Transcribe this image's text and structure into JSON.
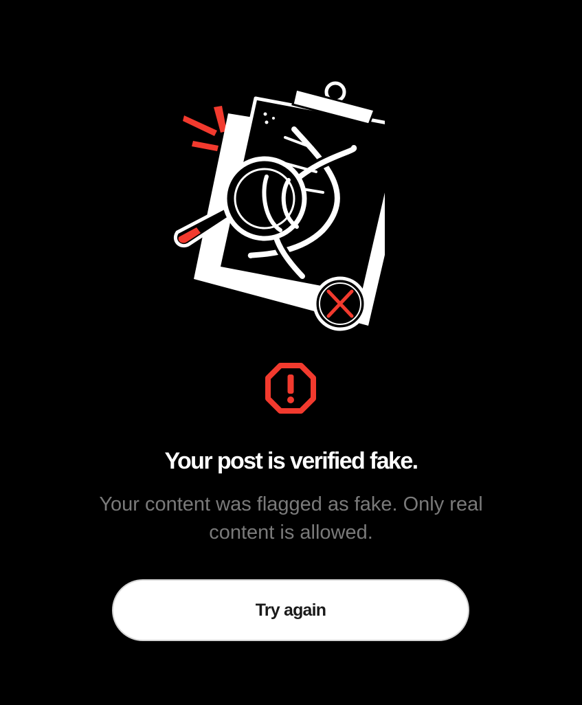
{
  "icons": {
    "illustration": "fake-document-magnifier-illustration",
    "alert": "octagon-exclamation-icon"
  },
  "colors": {
    "background": "#000000",
    "accent_red": "#f23a2e",
    "headline": "#ffffff",
    "subtext": "#7a7a7a",
    "button_bg": "#ffffff",
    "button_text": "#1a1a1a"
  },
  "message": {
    "title": "Your post is verified fake.",
    "body": "Your content was flagged as fake. Only real content is allowed."
  },
  "actions": {
    "try_again_label": "Try again"
  }
}
